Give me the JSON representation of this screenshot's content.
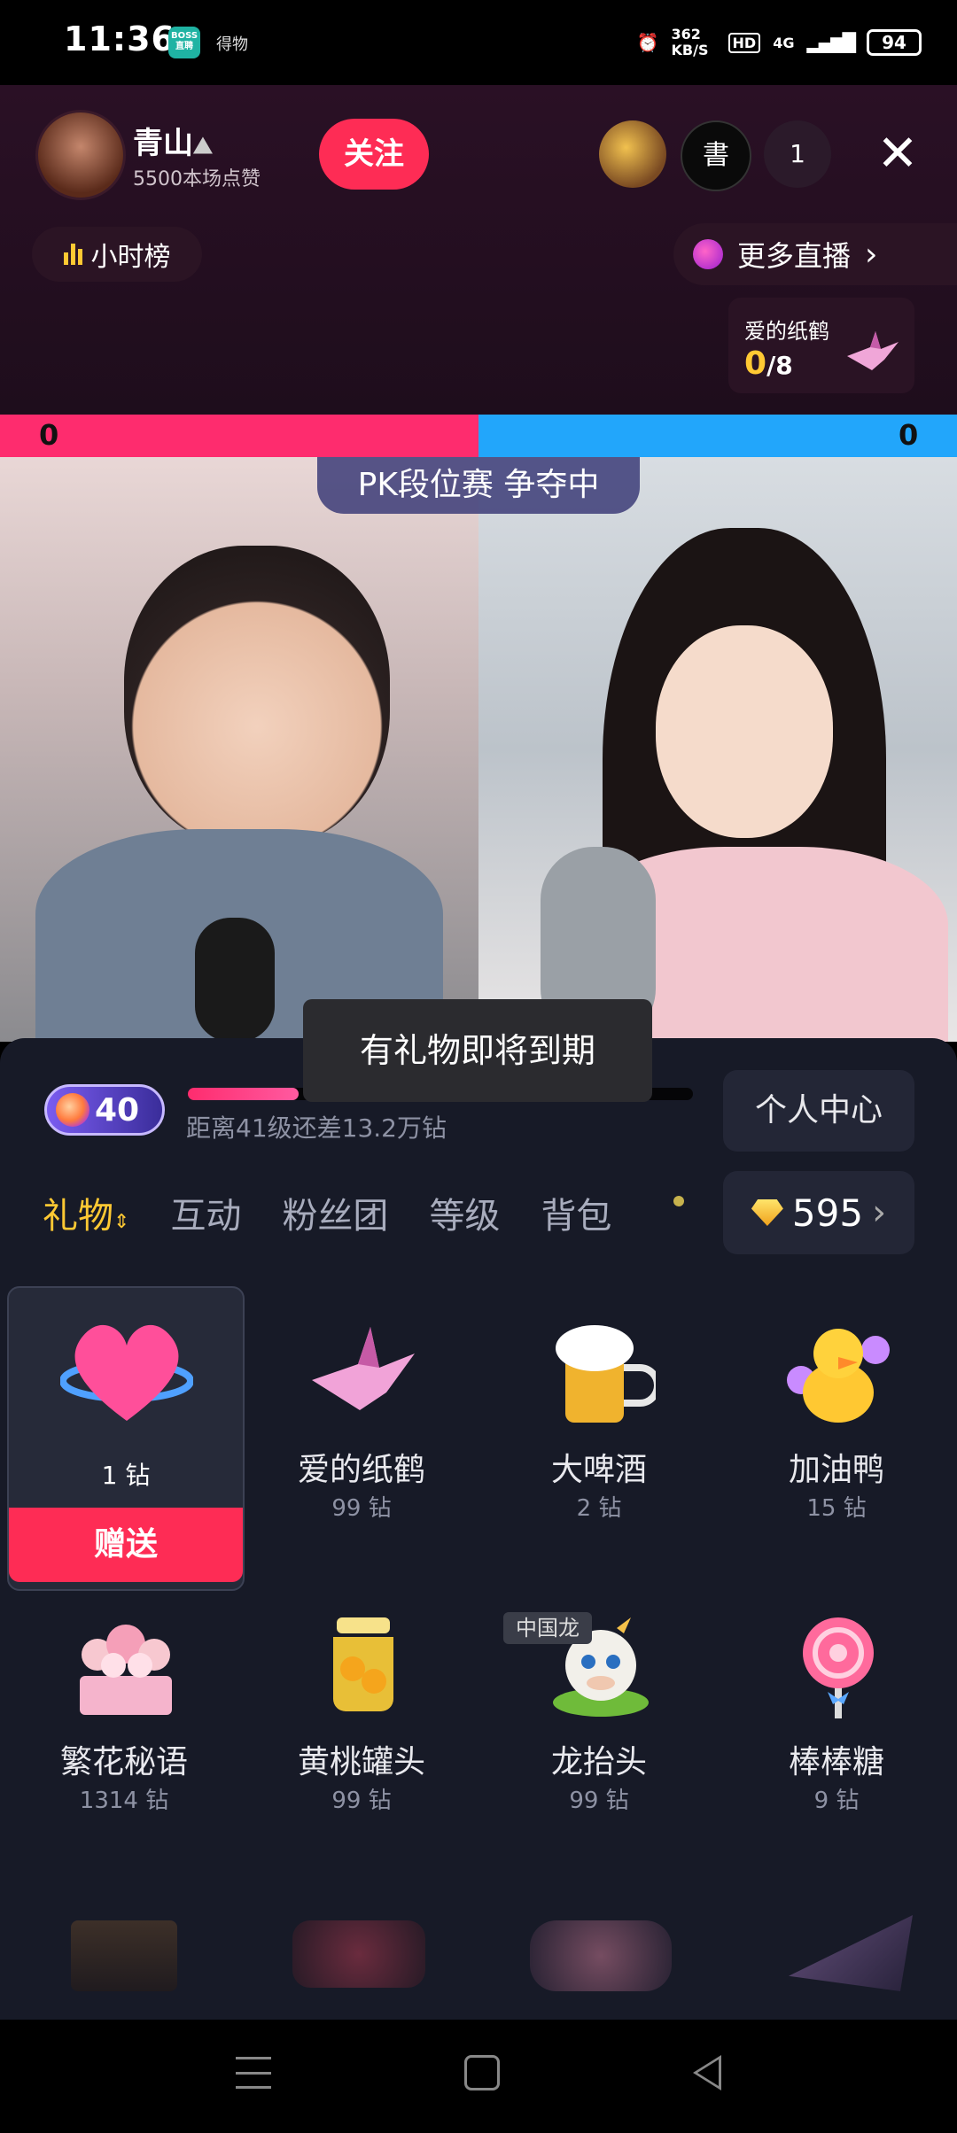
{
  "status_bar": {
    "time": "11:36",
    "app_badge": "BOSS直聘",
    "notification": "得物",
    "net_speed": "362 KB/S",
    "hd": "HD",
    "signal": "4G",
    "battery": "94"
  },
  "header": {
    "host_name": "青山",
    "host_likes": "5500本场点赞",
    "follow_label": "关注",
    "viewer_count": "1",
    "close_icon": "✕",
    "hourly_rank_label": "小时榜",
    "more_live_label": "更多直播",
    "task": {
      "title": "爱的纸鹤",
      "current": "0",
      "total": "/8"
    }
  },
  "pk": {
    "left_score": "0",
    "right_score": "0",
    "banner": "PK段位赛 争夺中"
  },
  "toast": "有礼物即将到期",
  "level": {
    "badge": "40",
    "progress_fraction": 0.22,
    "hint": "距离41级还差13.2万钻",
    "personal_center": "个人中心"
  },
  "tabs": [
    {
      "label": "礼物",
      "active": true
    },
    {
      "label": "互动"
    },
    {
      "label": "粉丝团"
    },
    {
      "label": "等级"
    },
    {
      "label": "背包"
    }
  ],
  "balance": "595",
  "gifts": [
    {
      "name": "",
      "price": "1 钻",
      "selected": true,
      "send_label": "赠送",
      "icon": "heart-icon"
    },
    {
      "name": "爱的纸鹤",
      "price": "99 钻",
      "icon": "paper-crane-icon"
    },
    {
      "name": "大啤酒",
      "price": "2 钻",
      "icon": "beer-mug-icon"
    },
    {
      "name": "加油鸭",
      "price": "15 钻",
      "icon": "cheer-duck-icon"
    },
    {
      "name": "繁花秘语",
      "price": "1314 钻",
      "icon": "flower-box-icon"
    },
    {
      "name": "黄桃罐头",
      "price": "99 钻",
      "icon": "peach-jar-icon"
    },
    {
      "name": "龙抬头",
      "price": "99 钻",
      "tag": "中国龙",
      "icon": "dragon-icon"
    },
    {
      "name": "棒棒糖",
      "price": "9 钻",
      "icon": "lollipop-icon"
    }
  ],
  "colors": {
    "accent_red": "#fe2c55",
    "pk_blue": "#22a6fb",
    "gold": "#ffc933",
    "panel_bg": "#171a27"
  }
}
